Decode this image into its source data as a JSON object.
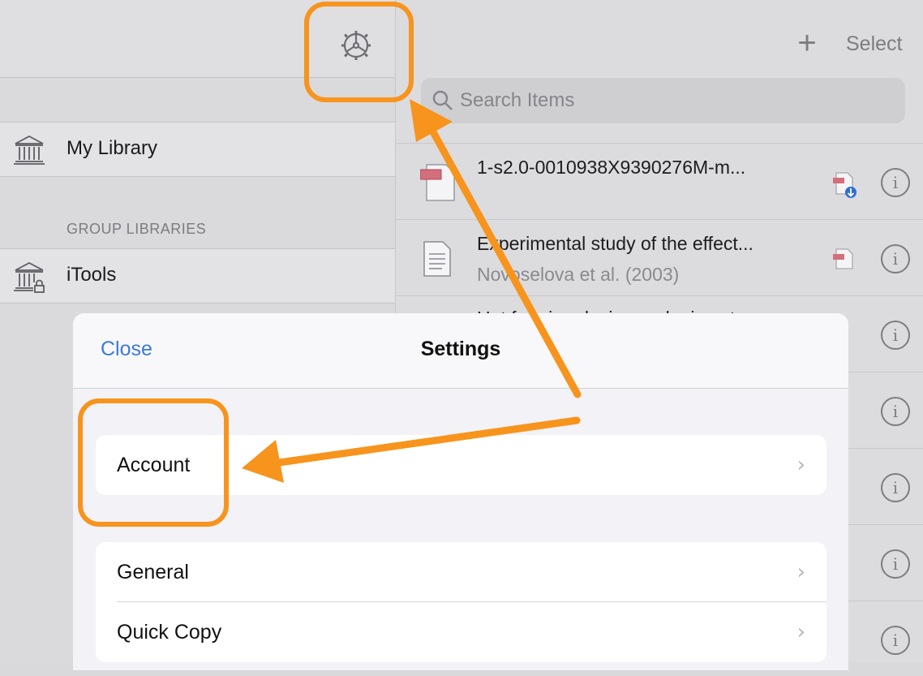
{
  "sidebar": {
    "my_library": "My Library",
    "section_title": "GROUP LIBRARIES",
    "group": "iTools"
  },
  "toolbar": {
    "select_label": "Select",
    "add_icon": "plus-icon",
    "settings_icon": "gear-icon"
  },
  "search": {
    "placeholder": "Search Items"
  },
  "items": [
    {
      "title": "1-s2.0-0010938X9390276M-m...",
      "subtitle": "",
      "icon": "pdf-document-icon"
    },
    {
      "title": "Experimental study of the effect...",
      "subtitle": "Novoselova et al. (2003)",
      "icon": "text-document-icon"
    },
    {
      "title": "Hot forming design and microstr...",
      "subtitle": ""
    }
  ],
  "settings": {
    "close_label": "Close",
    "title": "Settings",
    "account": "Account",
    "general": "General",
    "quick_copy": "Quick Copy"
  },
  "annotation": {
    "color": "#f7941d"
  }
}
